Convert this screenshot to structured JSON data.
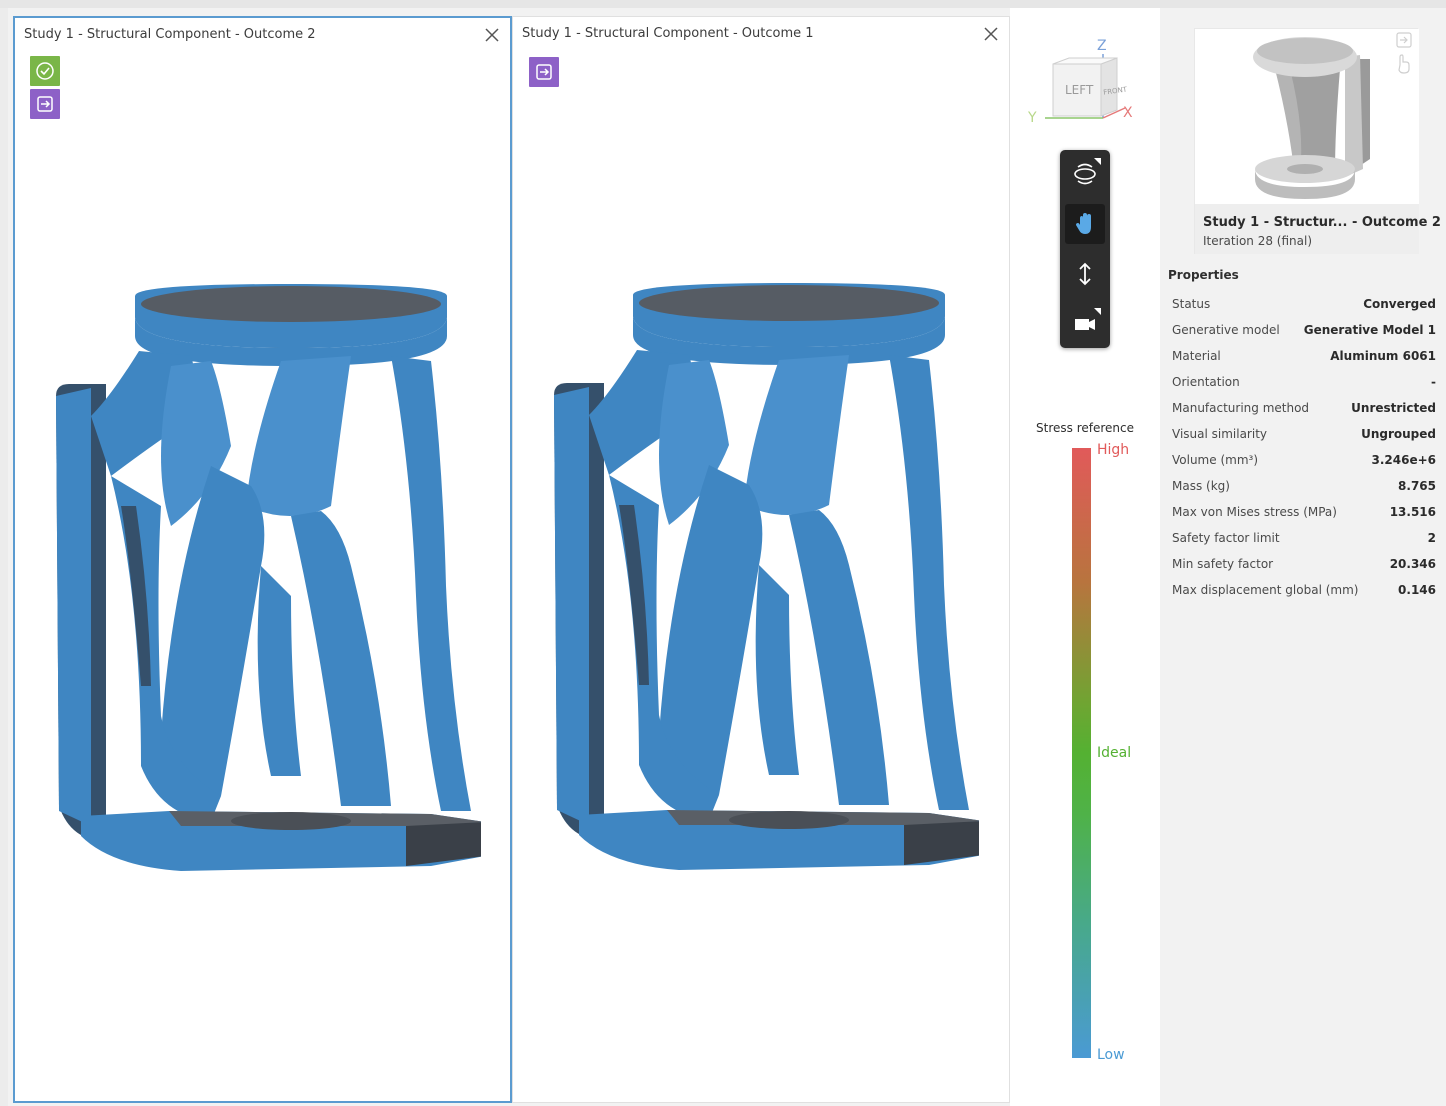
{
  "viewports": [
    {
      "title": "Study 1 - Structural Component - Outcome 2",
      "badges": [
        "check-icon",
        "export-icon"
      ]
    },
    {
      "title": "Study 1 - Structural Component - Outcome 1",
      "badges": [
        "export-icon"
      ]
    }
  ],
  "viewcube": {
    "face_front": "LEFT",
    "face_side": "FRONT",
    "axis_z": "Z",
    "axis_y": "Y",
    "axis_x": "X"
  },
  "toolbar": {
    "items": [
      "orbit-icon",
      "pan-icon",
      "zoom-icon",
      "camera-icon"
    ],
    "selected": "pan-icon"
  },
  "legend": {
    "title": "Stress reference",
    "high": "High",
    "ideal": "Ideal",
    "low": "Low",
    "colors": {
      "high": "#e15a5a",
      "ideal": "#54b132",
      "low": "#4a9ad4"
    }
  },
  "thumbnail": {
    "name": "Study 1 - Structur... - Outcome 2",
    "iteration": "Iteration 28 (final)"
  },
  "properties": {
    "title": "Properties",
    "rows": [
      {
        "label": "Status",
        "value": "Converged"
      },
      {
        "label": "Generative model",
        "value": "Generative Model 1"
      },
      {
        "label": "Material",
        "value": "Aluminum 6061"
      },
      {
        "label": "Orientation",
        "value": "-"
      },
      {
        "label": "Manufacturing method",
        "value": "Unrestricted"
      },
      {
        "label": "Visual similarity",
        "value": "Ungrouped"
      },
      {
        "label": "Volume (mm³)",
        "value": "3.246e+6"
      },
      {
        "label": "Mass (kg)",
        "value": "8.765"
      },
      {
        "label": "Max von Mises stress (MPa)",
        "value": "13.516"
      },
      {
        "label": "Safety factor limit",
        "value": "2"
      },
      {
        "label": "Min safety factor",
        "value": "20.346"
      },
      {
        "label": "Max displacement global (mm)",
        "value": "0.146"
      }
    ]
  },
  "colors": {
    "model_blue": "#3f86c2",
    "active_border": "#5b9bd0",
    "badge_green": "#7ab648",
    "badge_purple": "#8d61c7"
  }
}
